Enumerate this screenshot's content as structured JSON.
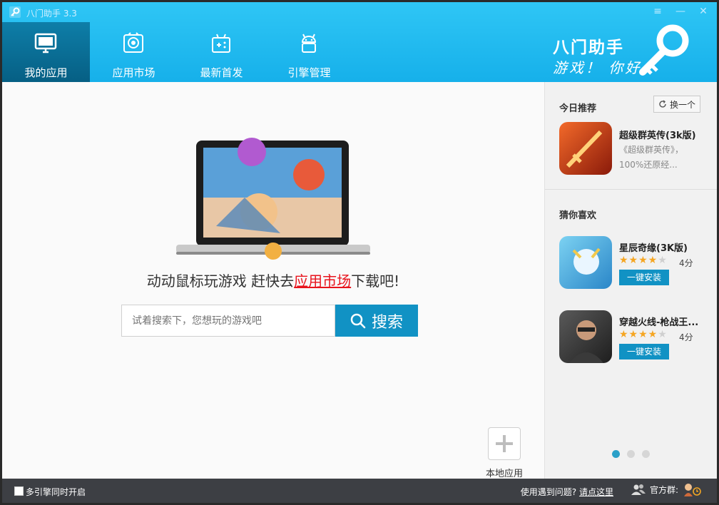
{
  "app": {
    "title": "八门助手 3.3"
  },
  "nav": {
    "tabs": [
      {
        "label": "我的应用",
        "icon": "monitor-icon",
        "active": true
      },
      {
        "label": "应用市场",
        "icon": "app-store-icon"
      },
      {
        "label": "最新首发",
        "icon": "gamepad-icon"
      },
      {
        "label": "引擎管理",
        "icon": "android-icon"
      }
    ]
  },
  "brand": {
    "line1": "八门助手",
    "line2": "游戏！ 你好"
  },
  "main": {
    "hint_prefix": "动动鼠标玩游戏 赶快去",
    "hint_link": "应用市场",
    "hint_suffix": "下载吧!",
    "search": {
      "placeholder": "试着搜索下，您想玩的游戏吧",
      "button_label": "搜索"
    },
    "local_app_label": "本地应用"
  },
  "sidebar": {
    "today": {
      "title": "今日推荐",
      "refresh_label": "换一个",
      "game": {
        "name": "超级群英传(3k版)",
        "desc": "《超级群英传》，100%还原经..."
      }
    },
    "guess": {
      "title": "猜你喜欢",
      "games": [
        {
          "name": "星辰奇缘(3K版)",
          "rating": 4,
          "max": 5,
          "score": "4分",
          "install_label": "一键安装"
        },
        {
          "name": "穿越火线-枪战王...",
          "rating": 4,
          "max": 5,
          "score": "4分",
          "install_label": "一键安装"
        }
      ]
    },
    "page_dots": 3,
    "active_dot": 0
  },
  "footer": {
    "multi_engine_label": "多引擎同时开启",
    "help_text": "使用遇到问题?",
    "help_link": "请点这里",
    "group_label": "官方群:"
  },
  "colors": {
    "header": "#16b0ea",
    "accent": "#1192c4",
    "link_red": "#e8141d",
    "footer": "#3d3f44"
  }
}
